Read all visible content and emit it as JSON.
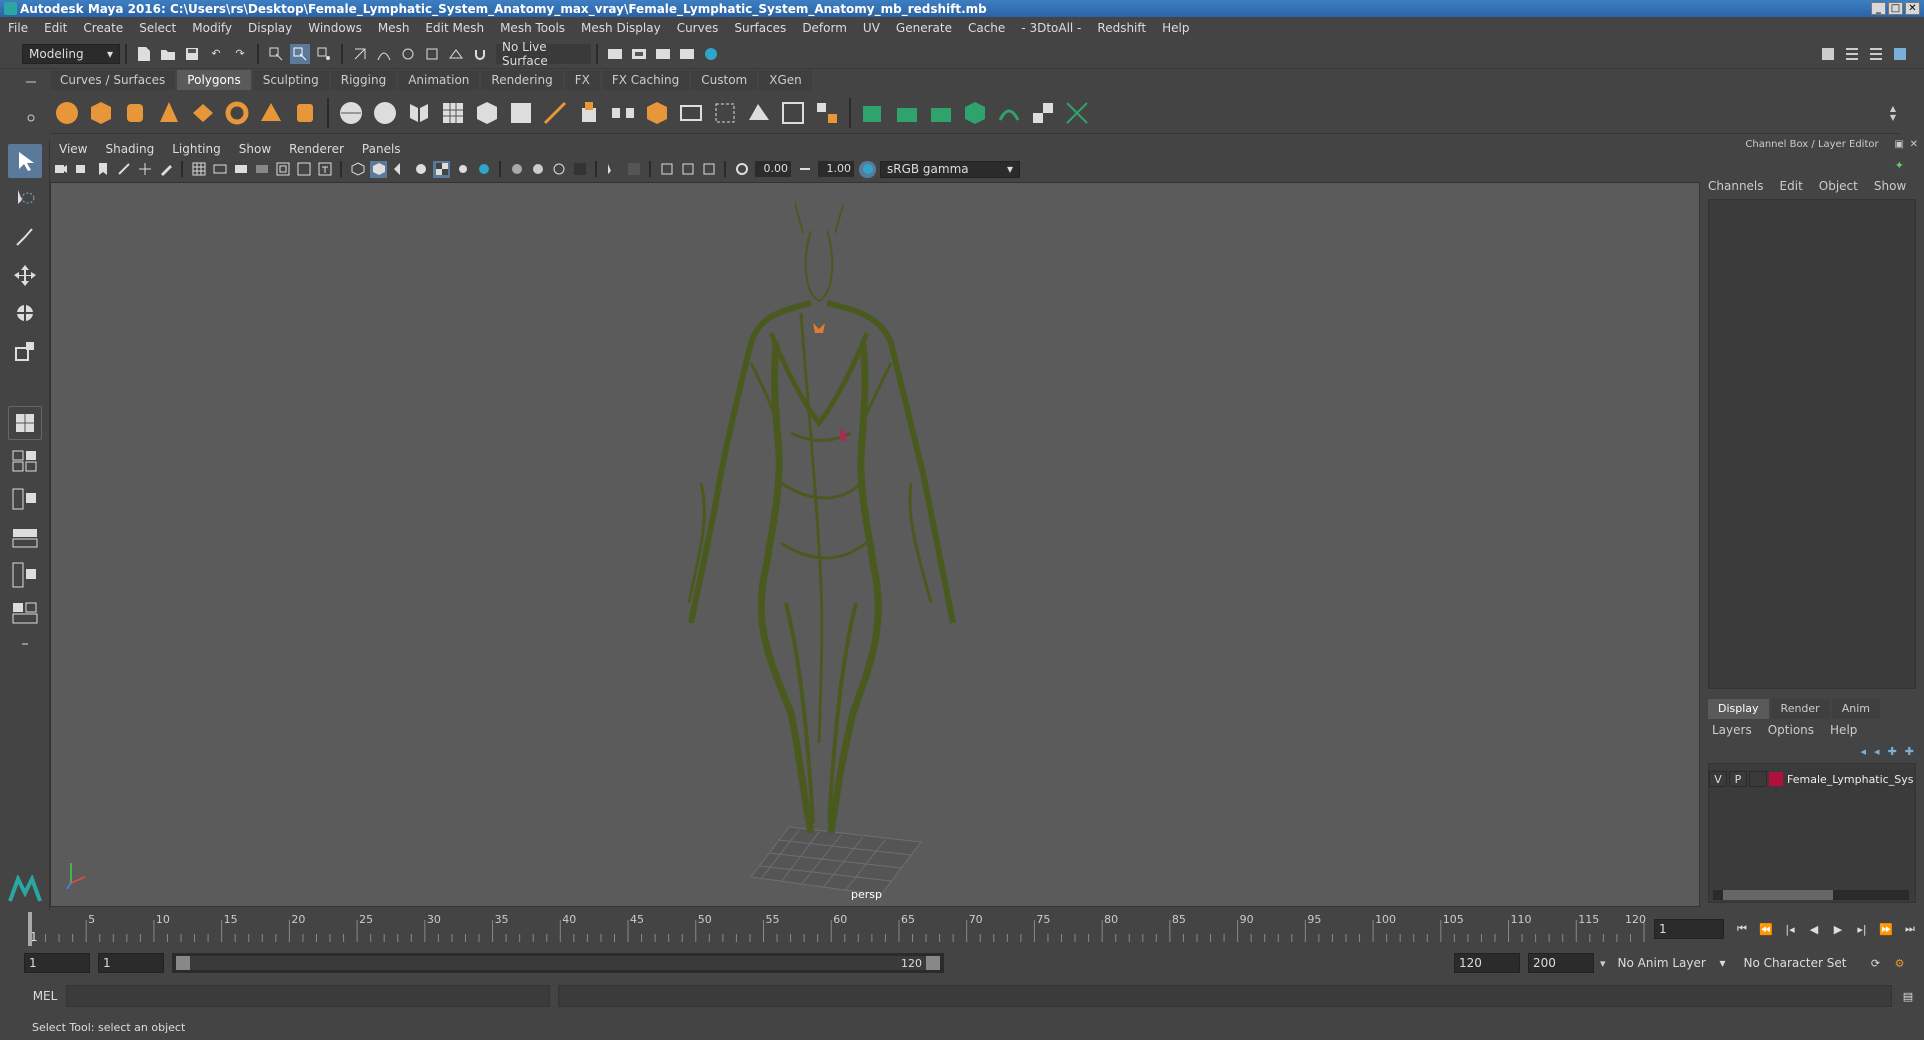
{
  "window": {
    "title": "Autodesk Maya 2016: C:\\Users\\rs\\Desktop\\Female_Lymphatic_System_Anatomy_max_vray\\Female_Lymphatic_System_Anatomy_mb_redshift.mb"
  },
  "menubar": [
    "File",
    "Edit",
    "Create",
    "Select",
    "Modify",
    "Display",
    "Windows",
    "Mesh",
    "Edit Mesh",
    "Mesh Tools",
    "Mesh Display",
    "Curves",
    "Surfaces",
    "Deform",
    "UV",
    "Generate",
    "Cache",
    "- 3DtoAll -",
    "Redshift",
    "Help"
  ],
  "statusline": {
    "mode": "Modeling",
    "live_surface": "No Live Surface"
  },
  "shelf_tabs": [
    "Curves / Surfaces",
    "Polygons",
    "Sculpting",
    "Rigging",
    "Animation",
    "Rendering",
    "FX",
    "FX Caching",
    "Custom",
    "XGen"
  ],
  "shelf_active": "Polygons",
  "viewport": {
    "menu": [
      "View",
      "Shading",
      "Lighting",
      "Show",
      "Renderer",
      "Panels"
    ],
    "exposure": "0.00",
    "gamma": "1.00",
    "colorspace": "sRGB gamma",
    "camera": "persp"
  },
  "rightpanel": {
    "title": "Channel Box / Layer Editor",
    "cb_menu": [
      "Channels",
      "Edit",
      "Object",
      "Show"
    ],
    "layer_tabs": [
      "Display",
      "Render",
      "Anim"
    ],
    "layer_menu": [
      "Layers",
      "Options",
      "Help"
    ],
    "layer": {
      "v": "V",
      "p": "P",
      "name": "Female_Lymphatic_Sys",
      "color": "#b0113a"
    }
  },
  "timeline": {
    "ticks": [
      "5",
      "10",
      "15",
      "20",
      "25",
      "30",
      "35",
      "40",
      "45",
      "50",
      "55",
      "60",
      "65",
      "70",
      "75",
      "80",
      "85",
      "90",
      "95",
      "100",
      "105",
      "110",
      "115",
      "120"
    ],
    "current_frame_label": "1",
    "current_frame_field": "1"
  },
  "range": {
    "start": "1",
    "anim_start": "1",
    "slider_start": "1",
    "slider_end": "120",
    "end": "120",
    "anim_end": "200",
    "anim_layer": "No Anim Layer",
    "char_set": "No Character Set"
  },
  "cmdline": {
    "label": "MEL"
  },
  "helpline": {
    "text": "Select Tool: select an object"
  },
  "colors": {
    "accent": "#5b7a99",
    "mesh": "#4a5a1e",
    "viewport_bg": "#5b5b5b"
  }
}
